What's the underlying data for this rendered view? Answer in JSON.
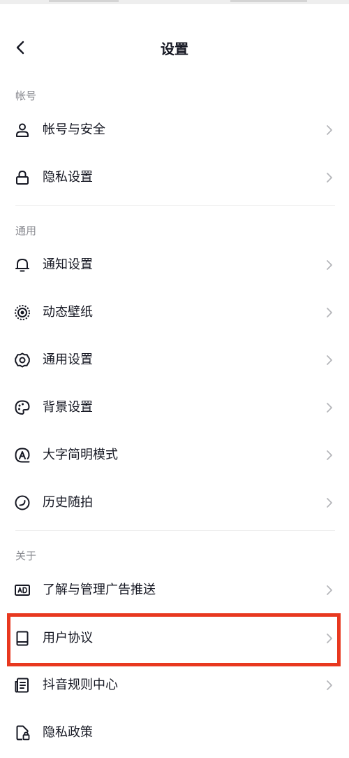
{
  "page": {
    "title": "设置"
  },
  "sections": {
    "account": {
      "header": "帐号",
      "items": [
        {
          "label": "帐号与安全",
          "icon": "user-icon"
        },
        {
          "label": "隐私设置",
          "icon": "lock-icon"
        }
      ]
    },
    "general": {
      "header": "通用",
      "items": [
        {
          "label": "通知设置",
          "icon": "bell-icon"
        },
        {
          "label": "动态壁纸",
          "icon": "live-wallpaper-icon"
        },
        {
          "label": "通用设置",
          "icon": "gear-icon"
        },
        {
          "label": "背景设置",
          "icon": "palette-icon"
        },
        {
          "label": "大字简明模式",
          "icon": "large-text-icon"
        },
        {
          "label": "历史随拍",
          "icon": "history-snap-icon"
        }
      ]
    },
    "about": {
      "header": "关于",
      "items": [
        {
          "label": "了解与管理广告推送",
          "icon": "ad-icon"
        },
        {
          "label": "用户协议",
          "icon": "book-icon",
          "highlighted": true
        },
        {
          "label": "抖音规则中心",
          "icon": "rules-document-icon"
        },
        {
          "label": "隐私政策",
          "icon": "privacy-policy-icon"
        }
      ]
    }
  },
  "colors": {
    "text": "#161823",
    "section_header": "#8a8b91",
    "chevron": "#b5b6ba",
    "divider": "#ececec",
    "highlight": "#e8381f"
  }
}
